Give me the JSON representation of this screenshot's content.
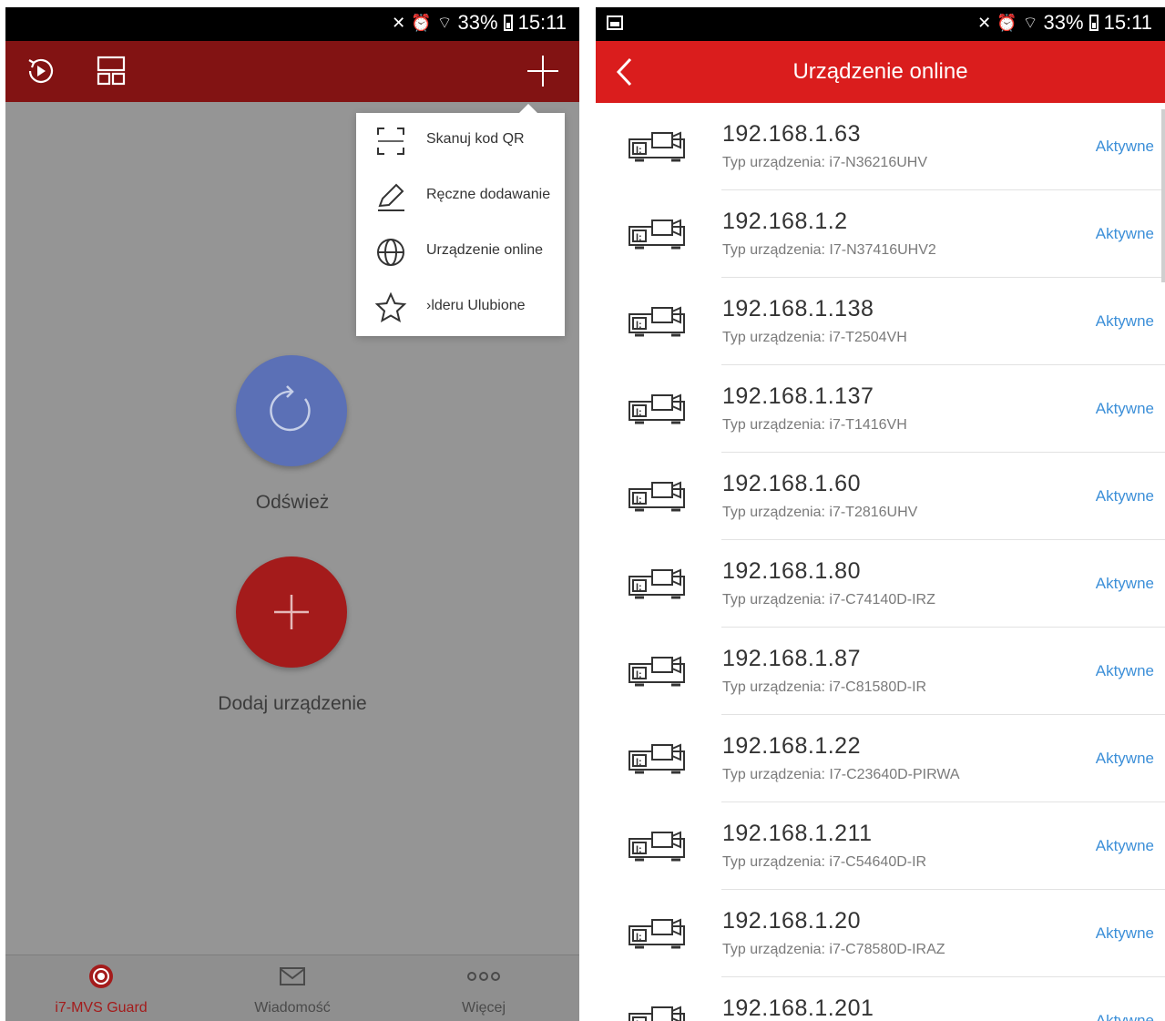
{
  "status_bar": {
    "battery": "33%",
    "time": "15:11"
  },
  "left_screen": {
    "refresh_label": "Odśwież",
    "add_label": "Dodaj urządzenie",
    "menu": [
      {
        "icon": "scan-qr-icon",
        "label": "Skanuj kod QR"
      },
      {
        "icon": "pencil-icon",
        "label": "Ręczne dodawanie"
      },
      {
        "icon": "globe-icon",
        "label": "Urządzenie online"
      },
      {
        "icon": "star-icon",
        "label": "›lderu Ulubione"
      }
    ],
    "bottom_nav": [
      {
        "icon": "guard-icon",
        "label": "i7-MVS Guard",
        "active": true
      },
      {
        "icon": "mail-icon",
        "label": "Wiadomość",
        "active": false
      },
      {
        "icon": "more-icon",
        "label": "Więcej",
        "active": false
      }
    ]
  },
  "right_screen": {
    "title": "Urządzenie online",
    "devices": [
      {
        "ip": "192.168.1.63",
        "type": "Typ urządzenia: i7-N36216UHV",
        "status": "Aktywne"
      },
      {
        "ip": "192.168.1.2",
        "type": "Typ urządzenia: I7-N37416UHV2",
        "status": "Aktywne"
      },
      {
        "ip": "192.168.1.138",
        "type": "Typ urządzenia: i7-T2504VH",
        "status": "Aktywne"
      },
      {
        "ip": "192.168.1.137",
        "type": "Typ urządzenia: i7-T1416VH",
        "status": "Aktywne"
      },
      {
        "ip": "192.168.1.60",
        "type": "Typ urządzenia: i7-T2816UHV",
        "status": "Aktywne"
      },
      {
        "ip": "192.168.1.80",
        "type": "Typ urządzenia: i7-C74140D-IRZ",
        "status": "Aktywne"
      },
      {
        "ip": "192.168.1.87",
        "type": "Typ urządzenia: i7-C81580D-IR",
        "status": "Aktywne"
      },
      {
        "ip": "192.168.1.22",
        "type": "Typ urządzenia: I7-C23640D-PIRWA",
        "status": "Aktywne"
      },
      {
        "ip": "192.168.1.211",
        "type": "Typ urządzenia: i7-C54640D-IR",
        "status": "Aktywne"
      },
      {
        "ip": "192.168.1.20",
        "type": "Typ urządzenia: i7-C78580D-IRAZ",
        "status": "Aktywne"
      },
      {
        "ip": "192.168.1.201",
        "type": "",
        "status": "Aktywne"
      }
    ]
  },
  "colors": {
    "toolbar_dark_red": "#821313",
    "toolbar_red": "#da1d1d",
    "accent_blue": "#3c8fd8",
    "refresh_blue": "#5b70b6",
    "add_red": "#a41b1b"
  }
}
